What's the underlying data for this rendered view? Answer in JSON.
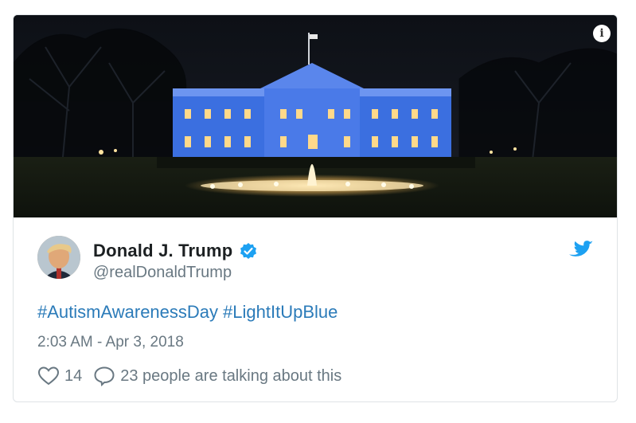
{
  "tweet": {
    "author_name": "Donald J. Trump",
    "handle": "@realDonaldTrump",
    "hashtags": [
      "#AutismAwarenessDay",
      "#LightItUpBlue"
    ],
    "timestamp": "2:03 AM - Apr 3, 2018",
    "likes": "14",
    "talking": "23 people are talking about this"
  },
  "icons": {
    "info": "info-icon",
    "verified": "verified-badge-icon",
    "brand": "twitter-bird-icon",
    "like": "heart-icon",
    "reply": "speech-bubble-icon"
  },
  "colors": {
    "link": "#2b7bb9",
    "muted": "#697882",
    "name": "#1c2022",
    "verified": "#1da1f2",
    "building_light": "#3f73e8"
  }
}
